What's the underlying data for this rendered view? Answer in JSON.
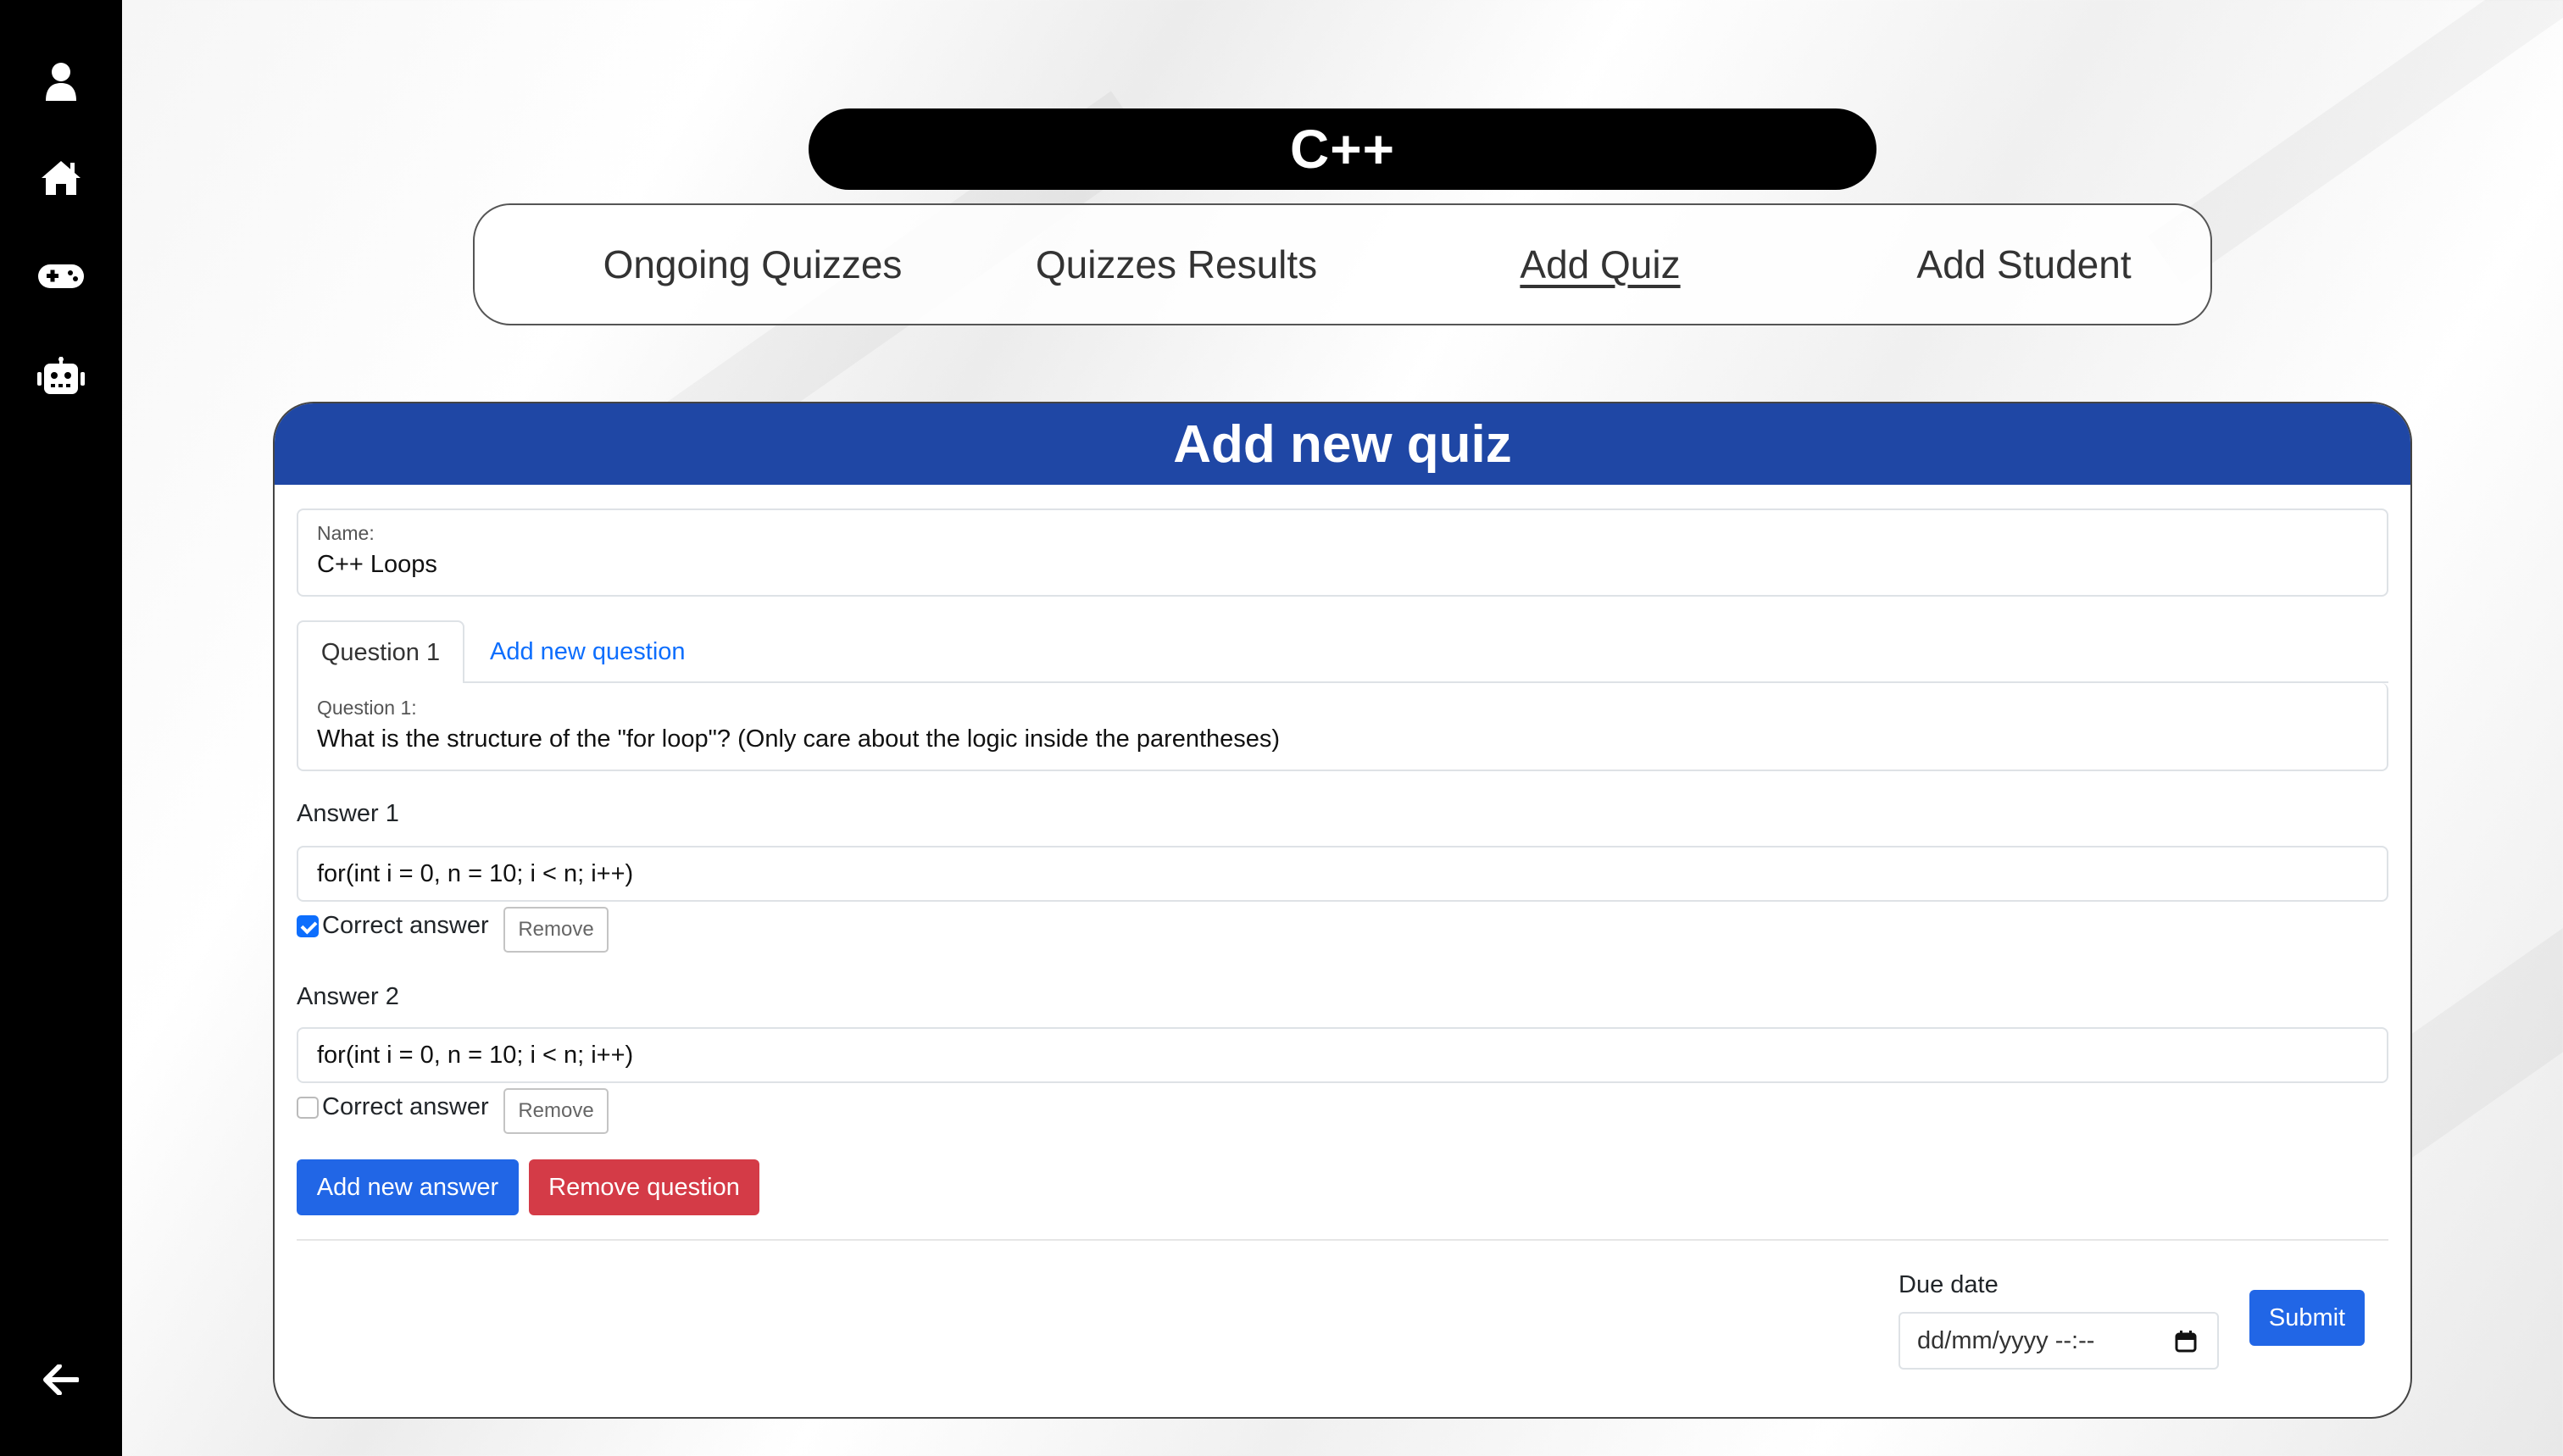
{
  "course_title": "C++",
  "nav": {
    "items": [
      {
        "label": "Ongoing Quizzes",
        "active": false
      },
      {
        "label": "Quizzes Results",
        "active": false
      },
      {
        "label": "Add Quiz",
        "active": true
      },
      {
        "label": "Add Student",
        "active": false
      }
    ]
  },
  "sidebar": {
    "icons": [
      "user-icon",
      "home-icon",
      "gamepad-icon",
      "robot-icon",
      "back-arrow-icon"
    ]
  },
  "form": {
    "header": "Add new quiz",
    "name_label": "Name:",
    "name_value": "C++ Loops",
    "tabs": {
      "active": "Question 1",
      "add_link": "Add new question"
    },
    "question": {
      "label": "Question 1:",
      "value": "What is the structure of the \"for loop\"? (Only care about the logic inside the parentheses)"
    },
    "answers": [
      {
        "label": "Answer 1",
        "value": "for(int i = 0, n = 10; i < n; i++)",
        "correct": true,
        "correct_label": "Correct answer",
        "remove_label": "Remove"
      },
      {
        "label": "Answer 2",
        "value": "for(int i = 0, n = 10; i < n; i++)",
        "correct": false,
        "correct_label": "Correct answer",
        "remove_label": "Remove"
      }
    ],
    "add_answer_label": "Add new answer",
    "remove_question_label": "Remove question",
    "due_date_label": "Due date",
    "due_date_placeholder": "dd/mm/yyyy --:--",
    "submit_label": "Submit"
  },
  "colors": {
    "header_blue": "#1f47a5",
    "primary_button": "#2166e6",
    "danger_button": "#d43b47",
    "link_blue": "#0d6efd"
  }
}
